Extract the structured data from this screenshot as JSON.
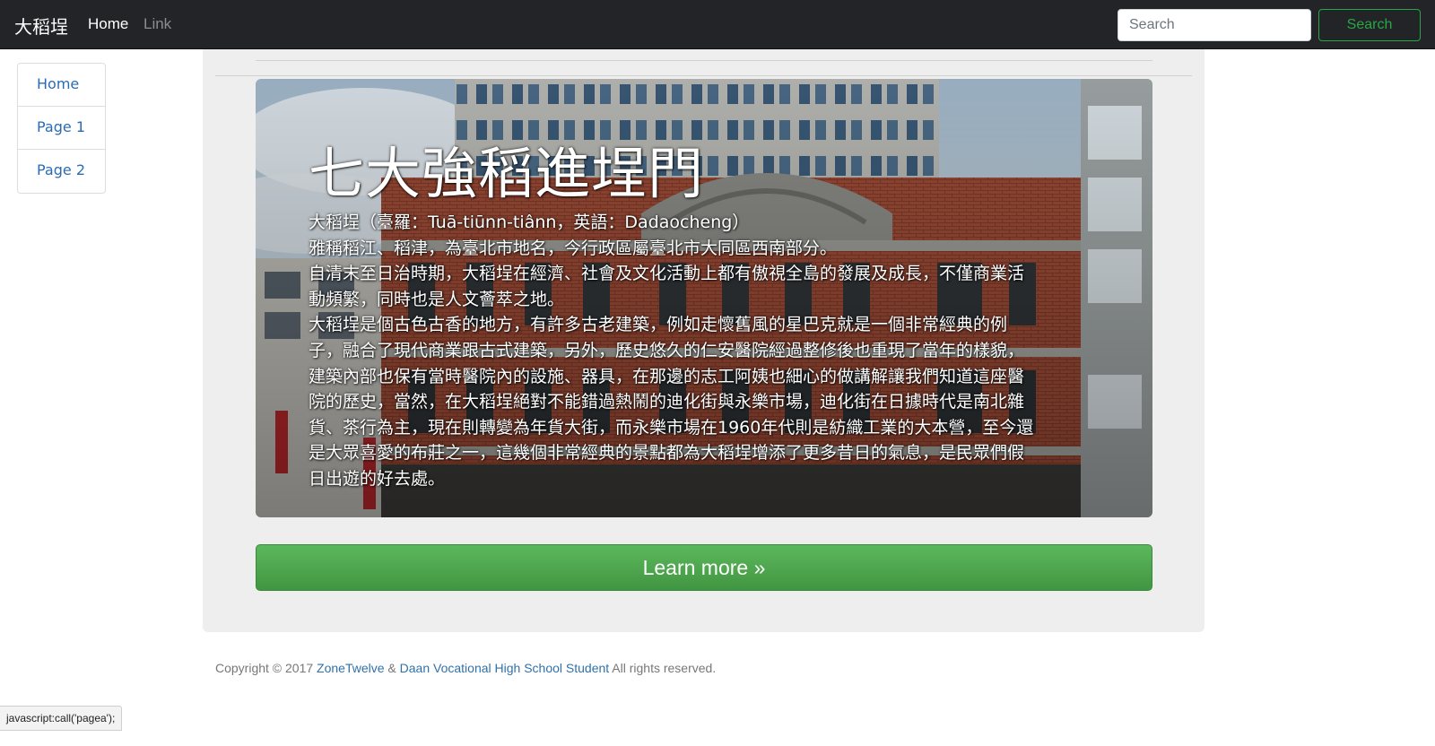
{
  "navbar": {
    "brand": "大稻埕",
    "links": [
      {
        "label": "Home",
        "active": true
      },
      {
        "label": "Link",
        "active": false
      }
    ],
    "search": {
      "placeholder": "Search",
      "value": "",
      "button_label": "Search"
    }
  },
  "sidebar": {
    "items": [
      {
        "label": "Home"
      },
      {
        "label": "Page 1"
      },
      {
        "label": "Page 2"
      }
    ]
  },
  "hero": {
    "title": "七大強稻進埕門",
    "lines": [
      "大稻埕（臺羅：Tuā-tiūnn-tiânn，英語：Dadaocheng）",
      "雅稱稻江、稻津，為臺北市地名，今行政區屬臺北市大同區西南部分。",
      "自清末至日治時期，大稻埕在經濟、社會及文化活動上都有傲視全島的發展及成長，不僅商業活",
      "動頻繁，同時也是人文薈萃之地。",
      "大稻埕是個古色古香的地方，有許多古老建築，例如走懷舊風的星巴克就是一個非常經典的例",
      "子，融合了現代商業跟古式建築，另外，歷史悠久的仁安醫院經過整修後也重現了當年的樣貌，",
      "建築內部也保有當時醫院內的設施、器具，在那邊的志工阿姨也細心的做講解讓我們知道這座醫",
      "院的歷史，當然，在大稻埕絕對不能錯過熱鬧的迪化街與永樂市場，迪化街在日據時代是南北雜",
      "貨、茶行為主，現在則轉變為年貨大街，而永樂市場在1960年代則是紡織工業的大本營，至今還",
      "是大眾喜愛的布莊之一，這幾個非常經典的景點都為大稻埕增添了更多昔日的氣息，是民眾們假",
      "日出遊的好去處。"
    ],
    "button_label": "Learn more »"
  },
  "footer": {
    "prefix": "Copyright © 2017 ",
    "link1": "ZoneTwelve",
    "separator": " & ",
    "link2": "Daan Vocational High School Student",
    "suffix": " All rights reserved."
  },
  "status_bar": {
    "text": "javascript:call('pagea');"
  },
  "colors": {
    "navbar_bg": "#222427",
    "panel_bg": "#eeeeee",
    "link_blue": "#2a6cb3",
    "success_green": "#28a745",
    "button_green": "#5cb85c"
  }
}
